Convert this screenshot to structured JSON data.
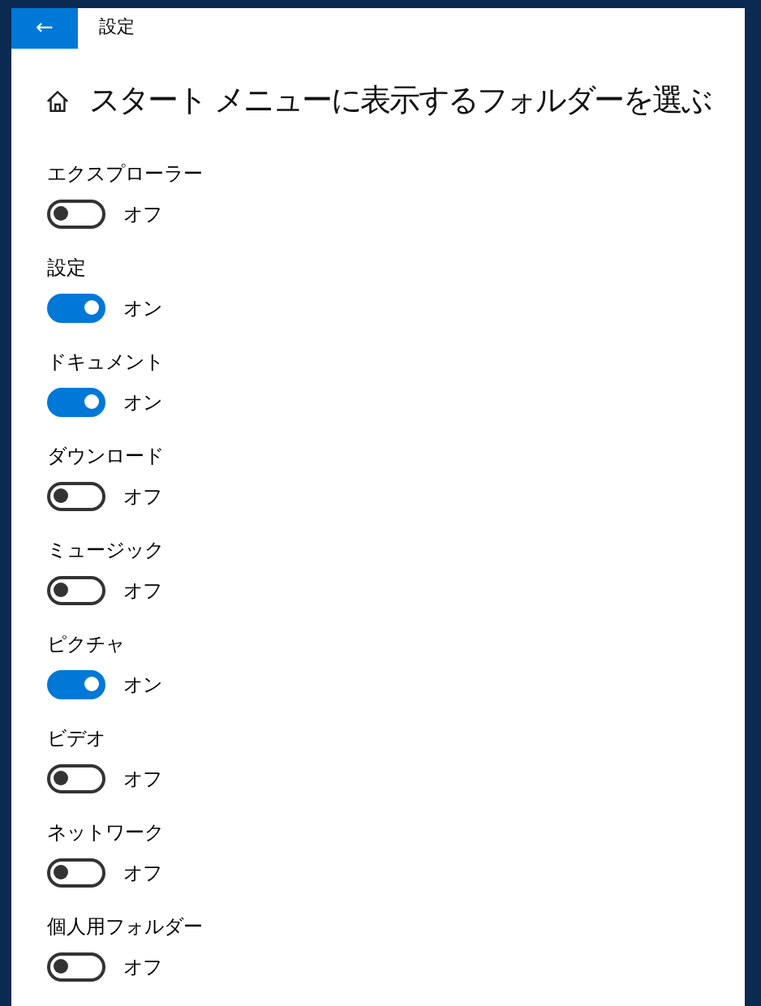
{
  "window": {
    "title": "設定",
    "back_button": "←"
  },
  "page": {
    "title": "スタート メニューに表示するフォルダーを選ぶ"
  },
  "folders": [
    {
      "label": "エクスプローラー",
      "on": false,
      "state_text": "オフ"
    },
    {
      "label": "設定",
      "on": true,
      "state_text": "オン"
    },
    {
      "label": "ドキュメント",
      "on": true,
      "state_text": "オン"
    },
    {
      "label": "ダウンロード",
      "on": false,
      "state_text": "オフ"
    },
    {
      "label": "ミュージック",
      "on": false,
      "state_text": "オフ"
    },
    {
      "label": "ピクチャ",
      "on": true,
      "state_text": "オン"
    },
    {
      "label": "ビデオ",
      "on": false,
      "state_text": "オフ"
    },
    {
      "label": "ネットワーク",
      "on": false,
      "state_text": "オフ"
    },
    {
      "label": "個人用フォルダー",
      "on": false,
      "state_text": "オフ"
    }
  ]
}
